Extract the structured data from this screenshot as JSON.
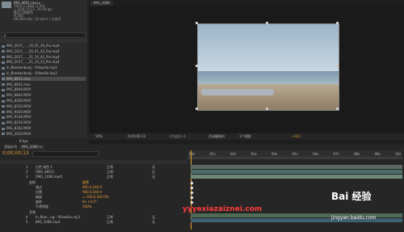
{
  "project": {
    "tab_label": "项目 ≡",
    "asset_name": "IMG_8851.mov ▸",
    "asset_info": [
      "1920 x 1080 (1.00)",
      "△ 0;00;19;11, 30.00 fps",
      "数百万种颜色",
      "H.264",
      "48.000 kHz / 32 bit U / 立体声"
    ],
    "search_placeholder": "ρ",
    "files": [
      "IMG_2017_..._19_01_49_Pro.mp4",
      "IMG_2017_..._19_01_42_Pro.mp4",
      "IMG_2017_..._21_10_41_Pro.mp4",
      "IMG_2017_..._21_13_33_Pro.mp4",
      "ln_Blankenburg - Villawilla.mp3",
      "ln_Blankenburg - Villawilla.mp3",
      "IMG_8851.mov",
      "IMG_8831.mov",
      "IMG_8840.MOV",
      "IMG_8842.MOV",
      "IMG_8200.MOV",
      "IMG_8150.MOV",
      "IMG_9020.MOV",
      "IMG_9146.MOV",
      "IMG_8234.MOV",
      "IMG_8302.MOV",
      "IMG_2010.MOV"
    ],
    "footer": "8 bpc"
  },
  "viewer": {
    "tab_label": "IMG_1086",
    "zoom": "50%",
    "timecode": "0;00;00;13",
    "resolution": "(二分之一)",
    "camera": "活动摄像机",
    "views": "1个视图",
    "exposure": "+0.0"
  },
  "timeline": {
    "tabs": [
      "渲染队列",
      "IMG_1086 ≡"
    ],
    "current_time": "0;00;00;13",
    "time_ruler": [
      "00s",
      "01s",
      "02s",
      "03s",
      "04s",
      "05s",
      "06s",
      "07s",
      "08s",
      "09s",
      "10s"
    ],
    "layers": [
      {
        "num": "1",
        "name": "白色 纯色 1",
        "mode": "正常",
        "parent": "无"
      },
      {
        "num": "2",
        "name": "[IMG_8851]",
        "mode": "正常",
        "parent": "无"
      },
      {
        "num": "3",
        "name": "[IMG_1086.mp4]",
        "mode": "正常",
        "parent": "无"
      }
    ],
    "transform_label": "变换",
    "transform_reset": "重置",
    "properties": [
      {
        "name": "锚点",
        "value": "960.0,540.0"
      },
      {
        "name": "位置",
        "value": "960.0,540.0"
      },
      {
        "name": "缩放",
        "value": "∞ 100.0,100.0%"
      },
      {
        "name": "旋转",
        "value": "0x +0.0°"
      },
      {
        "name": "不透明度",
        "value": "100%"
      }
    ],
    "audio_label": "音频",
    "bottom_layers": [
      {
        "num": "4",
        "name": "ln_Blan...ng - Villawilla.mp3",
        "mode": "正常",
        "parent": "无"
      },
      {
        "num": "5",
        "name": "IMG_1086.mp4",
        "mode": "正常",
        "parent": "无"
      }
    ]
  },
  "watermark": {
    "logo_text": "Bai 经验",
    "site": "jingyan.baidu.com",
    "red_text": "yyyexiazaiznei.com"
  }
}
